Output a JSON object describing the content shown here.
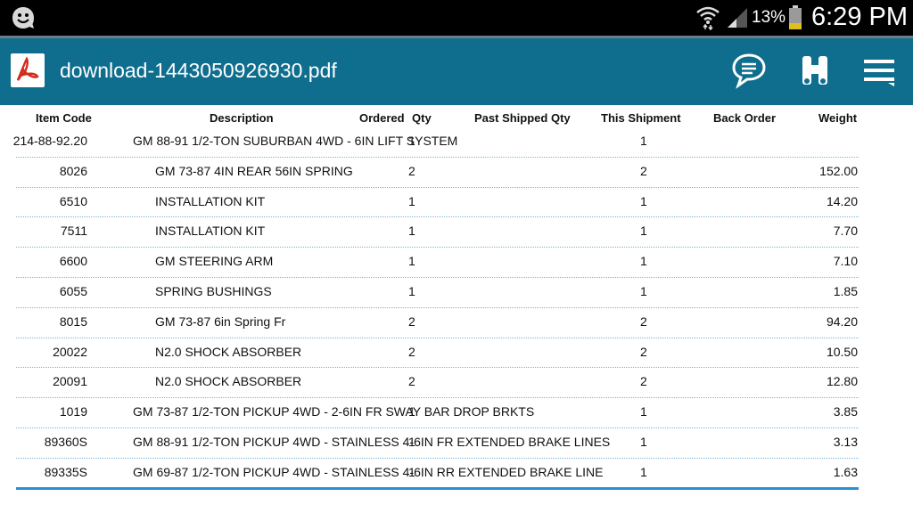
{
  "status_bar": {
    "battery_percent": "13%",
    "time": "6:29 PM",
    "icons": [
      "smiley-notification-icon",
      "wifi-icon",
      "signal-icon",
      "battery-icon"
    ]
  },
  "app_bar": {
    "title": "download-1443050926930.pdf",
    "background": "#0f6e8e",
    "icons": [
      "pdf-icon",
      "comment-icon",
      "binoculars-icon",
      "menu-icon"
    ]
  },
  "table": {
    "headers": {
      "item_code": "Item Code",
      "description": "Description",
      "ordered": "Ordered",
      "qty": "Qty",
      "past_shipped_qty": "Past Shipped Qty",
      "this_shipment": "This Shipment",
      "back_order": "Back Order",
      "weight": "Weight"
    },
    "rows": [
      {
        "code": "214-88-92.20",
        "desc": "GM 88-91 1/2-TON SUBURBAN 4WD - 6IN LIFT SYSTEM",
        "ordered": "1",
        "this_shipment": "1",
        "weight": "",
        "indent": false
      },
      {
        "code": "8026",
        "desc": "GM 73-87 4IN REAR 56IN SPRING",
        "ordered": "2",
        "this_shipment": "2",
        "weight": "152.00",
        "indent": true
      },
      {
        "code": "6510",
        "desc": "INSTALLATION KIT",
        "ordered": "1",
        "this_shipment": "1",
        "weight": "14.20",
        "indent": true
      },
      {
        "code": "7511",
        "desc": "INSTALLATION KIT",
        "ordered": "1",
        "this_shipment": "1",
        "weight": "7.70",
        "indent": true
      },
      {
        "code": "6600",
        "desc": "GM STEERING ARM",
        "ordered": "1",
        "this_shipment": "1",
        "weight": "7.10",
        "indent": true
      },
      {
        "code": "6055",
        "desc": "SPRING BUSHINGS",
        "ordered": "1",
        "this_shipment": "1",
        "weight": "1.85",
        "indent": true
      },
      {
        "code": "8015",
        "desc": "GM 73-87 6in Spring Fr",
        "ordered": "2",
        "this_shipment": "2",
        "weight": "94.20",
        "indent": true
      },
      {
        "code": "20022",
        "desc": "N2.0 SHOCK ABSORBER",
        "ordered": "2",
        "this_shipment": "2",
        "weight": "10.50",
        "indent": true
      },
      {
        "code": "20091",
        "desc": "N2.0 SHOCK ABSORBER",
        "ordered": "2",
        "this_shipment": "2",
        "weight": "12.80",
        "indent": true
      },
      {
        "code": "1019",
        "desc": "GM 73-87 1/2-TON PICKUP 4WD - 2-6IN FR SWAY BAR DROP BRKTS",
        "ordered": "1",
        "this_shipment": "1",
        "weight": "3.85",
        "indent": false
      },
      {
        "code": "89360S",
        "desc": "GM 88-91 1/2-TON PICKUP 4WD - STAINLESS 4-6IN FR EXTENDED BRAKE LINES",
        "ordered": "1",
        "this_shipment": "1",
        "weight": "3.13",
        "indent": false
      },
      {
        "code": "89335S",
        "desc": "GM 69-87 1/2-TON PICKUP 4WD - STAINLESS 4-6IN RR EXTENDED BRAKE LINE",
        "ordered": "1",
        "this_shipment": "1",
        "weight": "1.63",
        "indent": false
      }
    ]
  }
}
